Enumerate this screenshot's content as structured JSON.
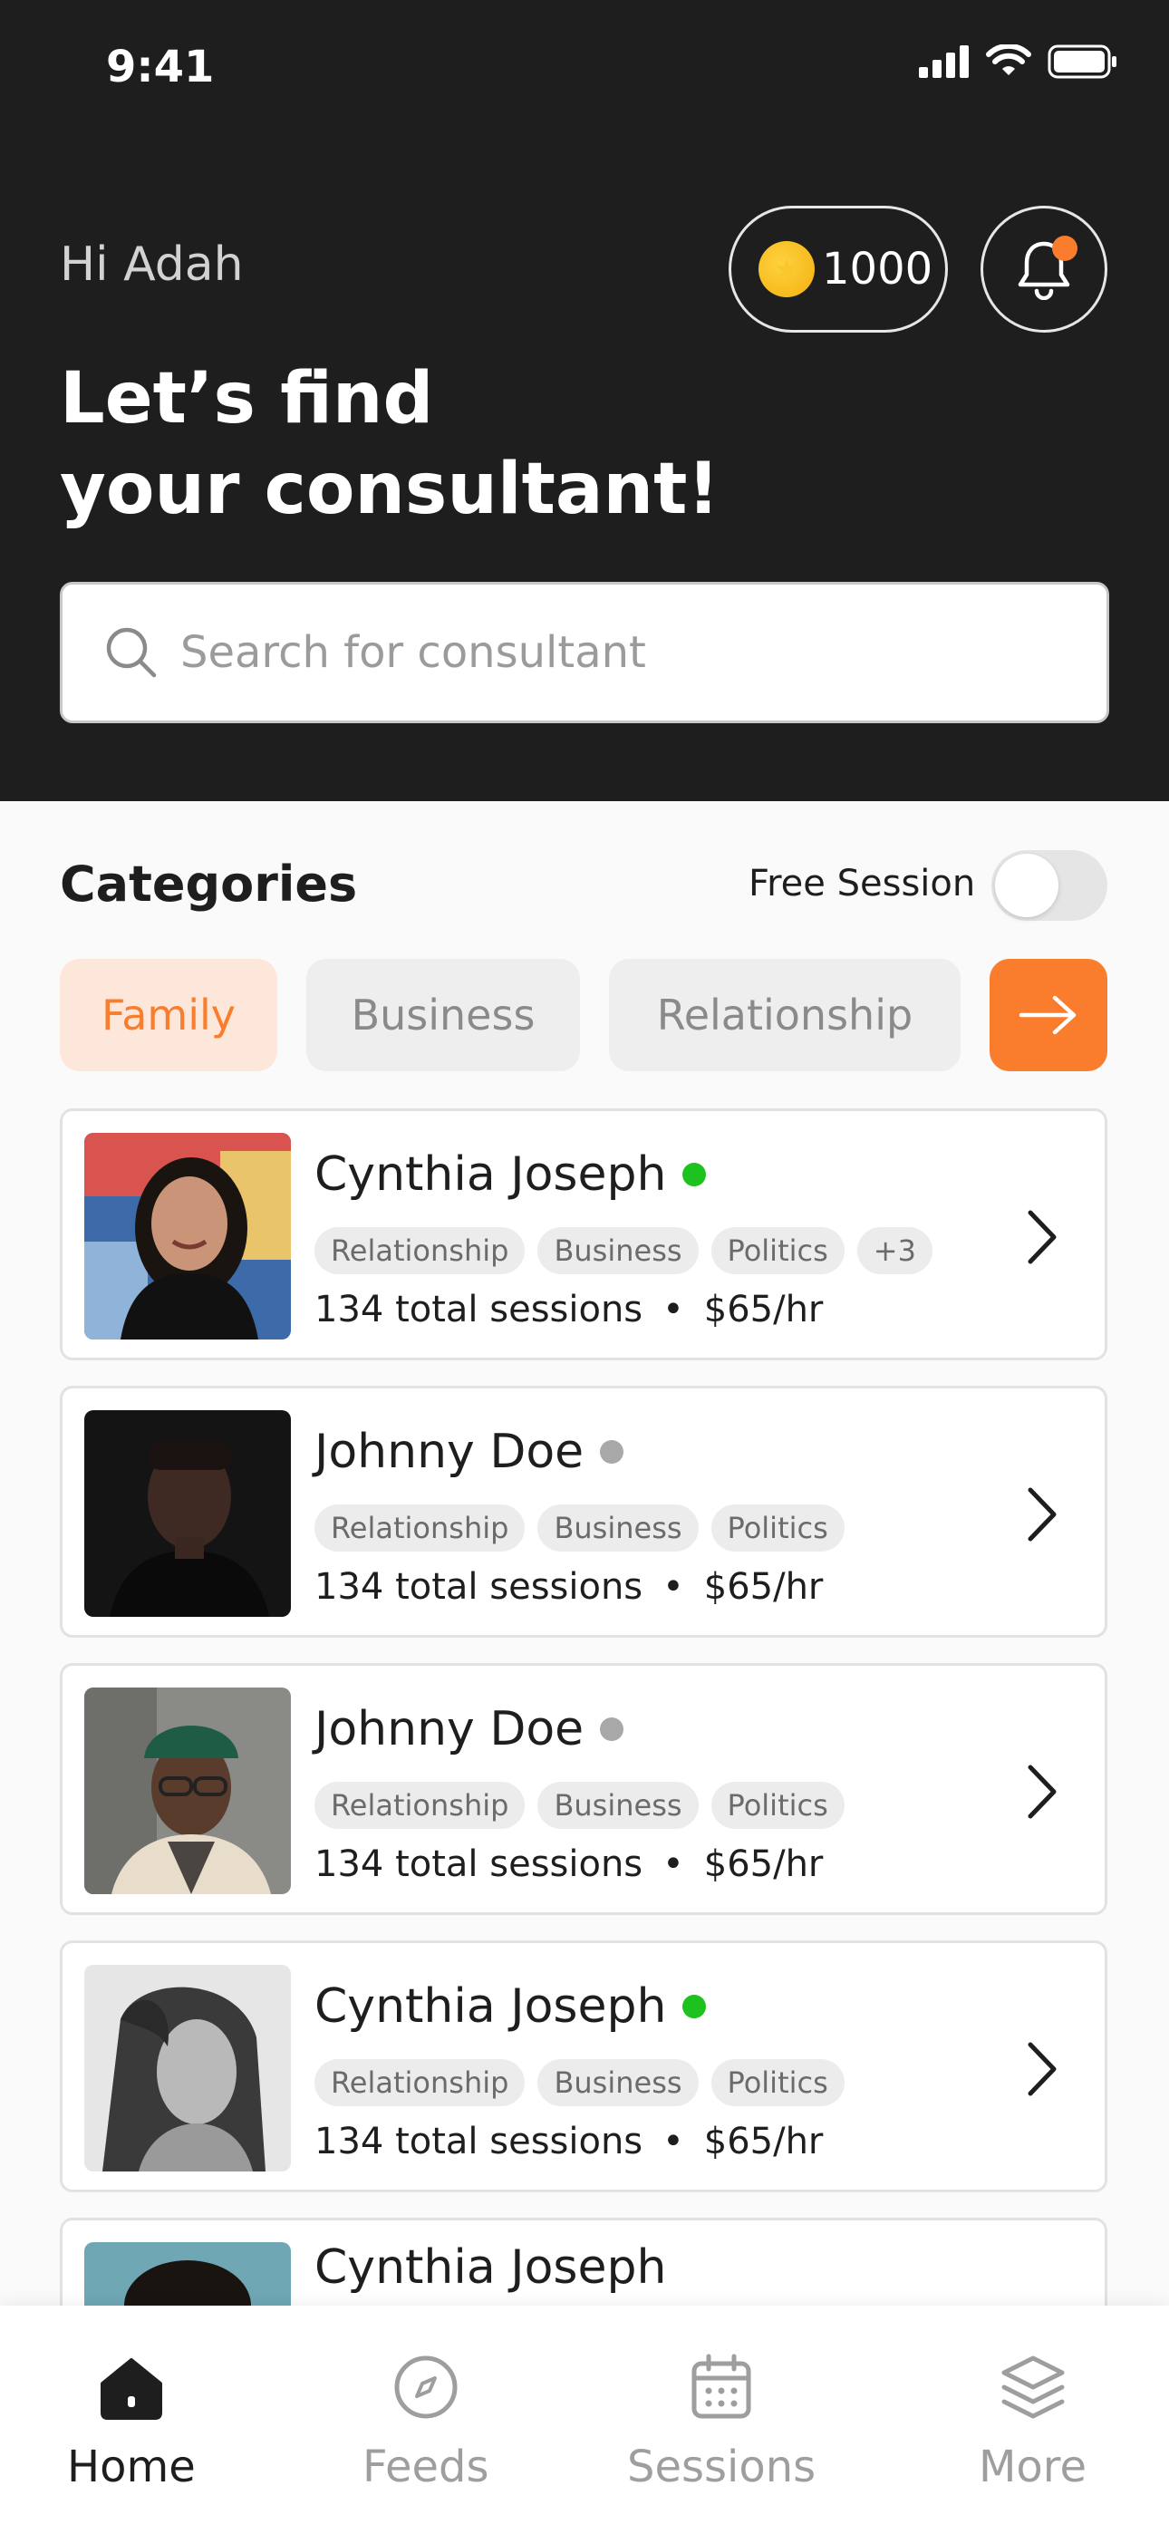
{
  "status_bar": {
    "time": "9:41"
  },
  "header": {
    "greeting": "Hi Adah",
    "headline_line1": "Let’s find",
    "headline_line2": "your consultant!",
    "coins": "1000"
  },
  "search": {
    "placeholder": "Search for consultant"
  },
  "categories": {
    "title": "Categories",
    "free_session_label": "Free Session",
    "free_session_on": false,
    "chips": [
      "Family",
      "Business",
      "Relationship"
    ],
    "selected": "Family"
  },
  "consultants": [
    {
      "name": "Cynthia Joseph",
      "online": true,
      "tags": [
        "Relationship",
        "Business",
        "Politics",
        "+3"
      ],
      "sessions": "134 total sessions",
      "rate": "$65/hr"
    },
    {
      "name": "Johnny Doe",
      "online": false,
      "tags": [
        "Relationship",
        "Business",
        "Politics"
      ],
      "sessions": "134 total sessions",
      "rate": "$65/hr"
    },
    {
      "name": "Johnny Doe",
      "online": false,
      "tags": [
        "Relationship",
        "Business",
        "Politics"
      ],
      "sessions": "134 total sessions",
      "rate": "$65/hr"
    },
    {
      "name": "Cynthia Joseph",
      "online": true,
      "tags": [
        "Relationship",
        "Business",
        "Politics"
      ],
      "sessions": "134 total sessions",
      "rate": "$65/hr"
    },
    {
      "name": "Cynthia Joseph"
    }
  ],
  "separator": "•",
  "bottom_nav": [
    {
      "label": "Home",
      "icon": "home-icon",
      "active": true
    },
    {
      "label": "Feeds",
      "icon": "compass-icon",
      "active": false
    },
    {
      "label": "Sessions",
      "icon": "calendar-icon",
      "active": false
    },
    {
      "label": "More",
      "icon": "layers-icon",
      "active": false
    }
  ],
  "colors": {
    "accent": "#f97d2c",
    "online": "#1ec21e",
    "offline": "#a8a8a8",
    "dark": "#1e1e1e"
  }
}
